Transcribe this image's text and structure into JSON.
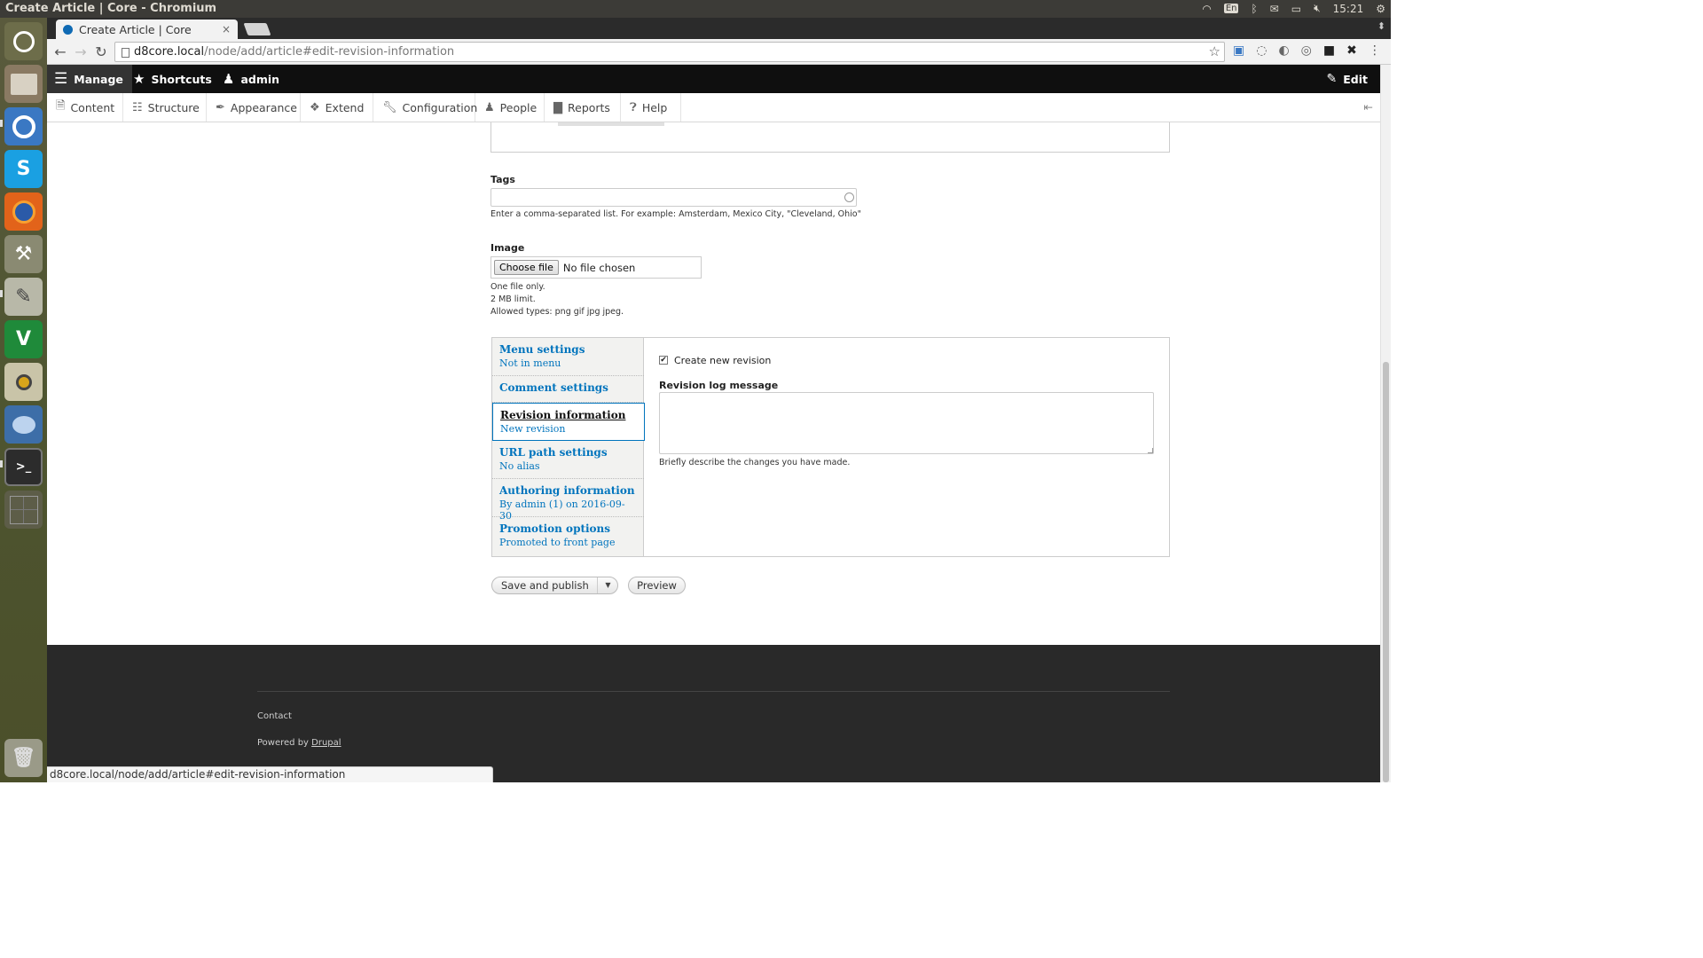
{
  "os": {
    "window_title": "Create Article | Core - Chromium",
    "tray": {
      "lang": "En",
      "time": "15:21"
    }
  },
  "launcher": {
    "apps": [
      "ubuntu-dash-icon",
      "files-icon",
      "chromium-icon",
      "skype-icon",
      "firefox-icon",
      "system-settings-icon",
      "text-editor-icon",
      "vim-icon",
      "rhythmbox-icon",
      "thunderbird-icon",
      "terminal-icon",
      "workspace-switcher-icon",
      "trash-icon"
    ]
  },
  "browser": {
    "tab_title": "Create Article | Core",
    "tab_close": "×",
    "url_host": "d8core.local",
    "url_path": "/node/add/article#edit-revision-information",
    "status_url": "d8core.local/node/add/article#edit-revision-information"
  },
  "admin_toolbar": {
    "manage": "Manage",
    "shortcuts": "Shortcuts",
    "user": "admin",
    "edit": "Edit"
  },
  "tray": {
    "items": [
      "Content",
      "Structure",
      "Appearance",
      "Extend",
      "Configuration",
      "People",
      "Reports",
      "Help"
    ]
  },
  "form": {
    "tags": {
      "label": "Tags",
      "description": "Enter a comma-separated list. For example: Amsterdam, Mexico City, \"Cleveland, Ohio\""
    },
    "image": {
      "label": "Image",
      "button": "Choose file",
      "status": "No file chosen",
      "help": [
        "One file only.",
        "2 MB limit.",
        "Allowed types: png gif jpg jpeg."
      ]
    },
    "vertical_tabs": [
      {
        "title": "Menu settings",
        "summary": "Not in menu"
      },
      {
        "title": "Comment settings",
        "summary": ""
      },
      {
        "title": "Revision information",
        "summary": "New revision"
      },
      {
        "title": "URL path settings",
        "summary": "No alias"
      },
      {
        "title": "Authoring information",
        "summary": "By admin (1) on 2016-09-30"
      },
      {
        "title": "Promotion options",
        "summary": "Promoted to front page"
      }
    ],
    "revision": {
      "checkbox_label": "Create new revision",
      "checked": true,
      "log_label": "Revision log message",
      "log_value": "",
      "log_description": "Briefly describe the changes you have made."
    },
    "actions": {
      "save": "Save and publish",
      "preview": "Preview"
    }
  },
  "footer": {
    "contact": "Contact",
    "powered_prefix": "Powered by",
    "powered_link": "Drupal"
  }
}
